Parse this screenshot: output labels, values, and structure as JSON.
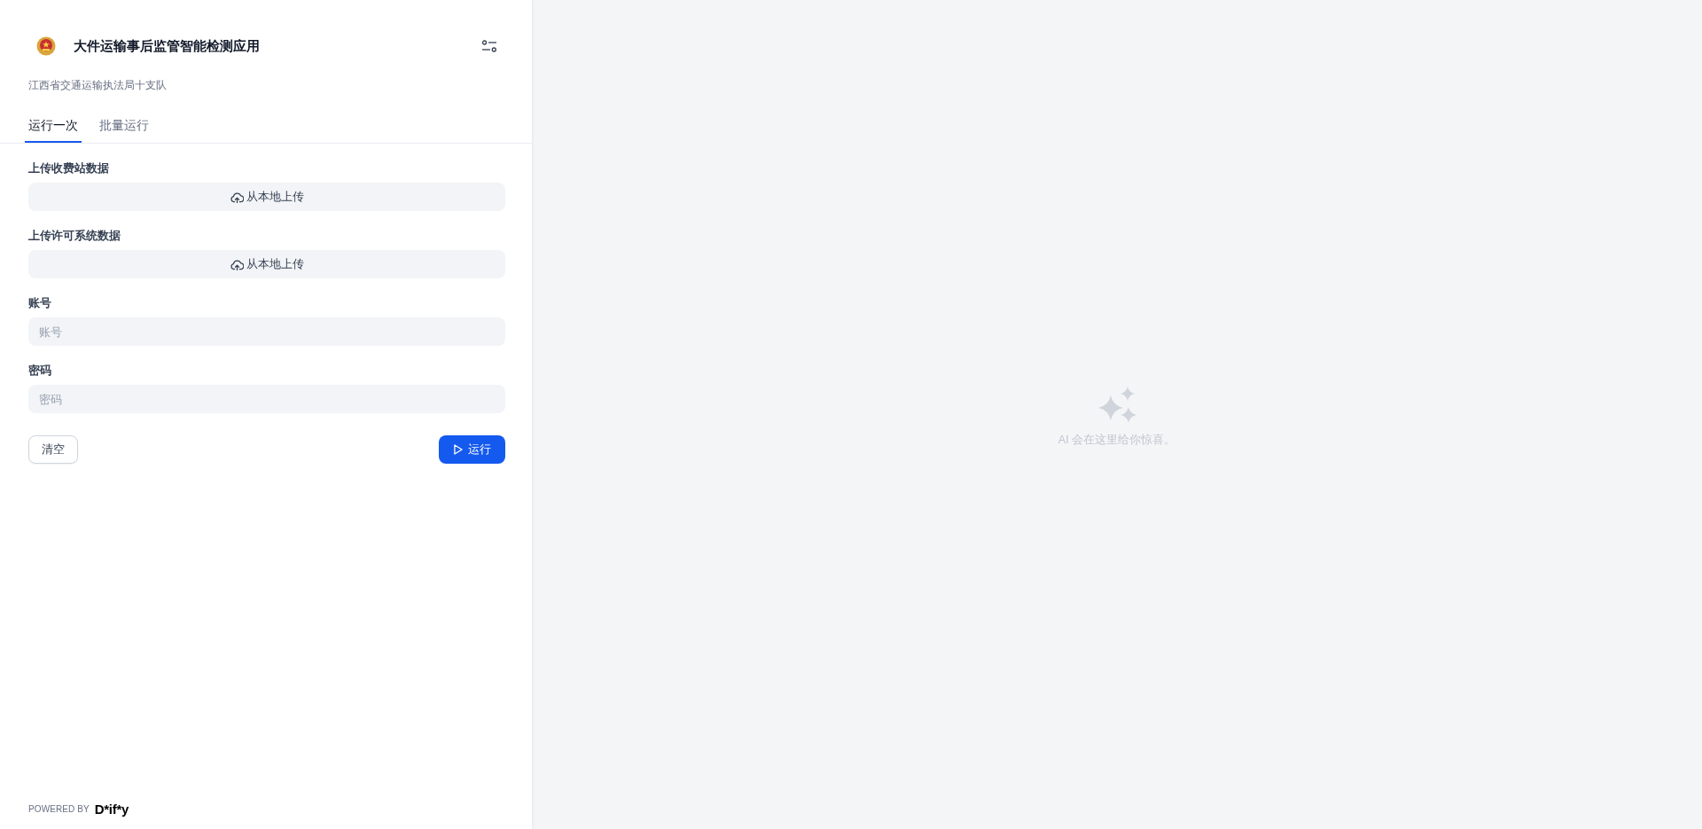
{
  "app": {
    "title": "大件运输事后监管智能检测应用",
    "subtitle": "江西省交通运输执法局十支队"
  },
  "tabs": [
    {
      "label": "运行一次",
      "selected": true
    },
    {
      "label": "批量运行",
      "selected": false
    }
  ],
  "form": {
    "fields": [
      {
        "kind": "upload",
        "label": "上传收费站数据",
        "button": "从本地上传"
      },
      {
        "kind": "upload",
        "label": "上传许可系统数据",
        "button": "从本地上传"
      },
      {
        "kind": "text",
        "label": "账号",
        "placeholder": "账号"
      },
      {
        "kind": "password",
        "label": "密码",
        "placeholder": "密码"
      }
    ],
    "actions": [
      {
        "kind": "secondary",
        "label": "清空"
      },
      {
        "kind": "primary",
        "label": "运行"
      }
    ]
  },
  "result": {
    "empty_message": "AI 会在这里给你惊喜。"
  },
  "footer": {
    "powered_by": "POWERED BY",
    "brand": "D*if*y"
  }
}
